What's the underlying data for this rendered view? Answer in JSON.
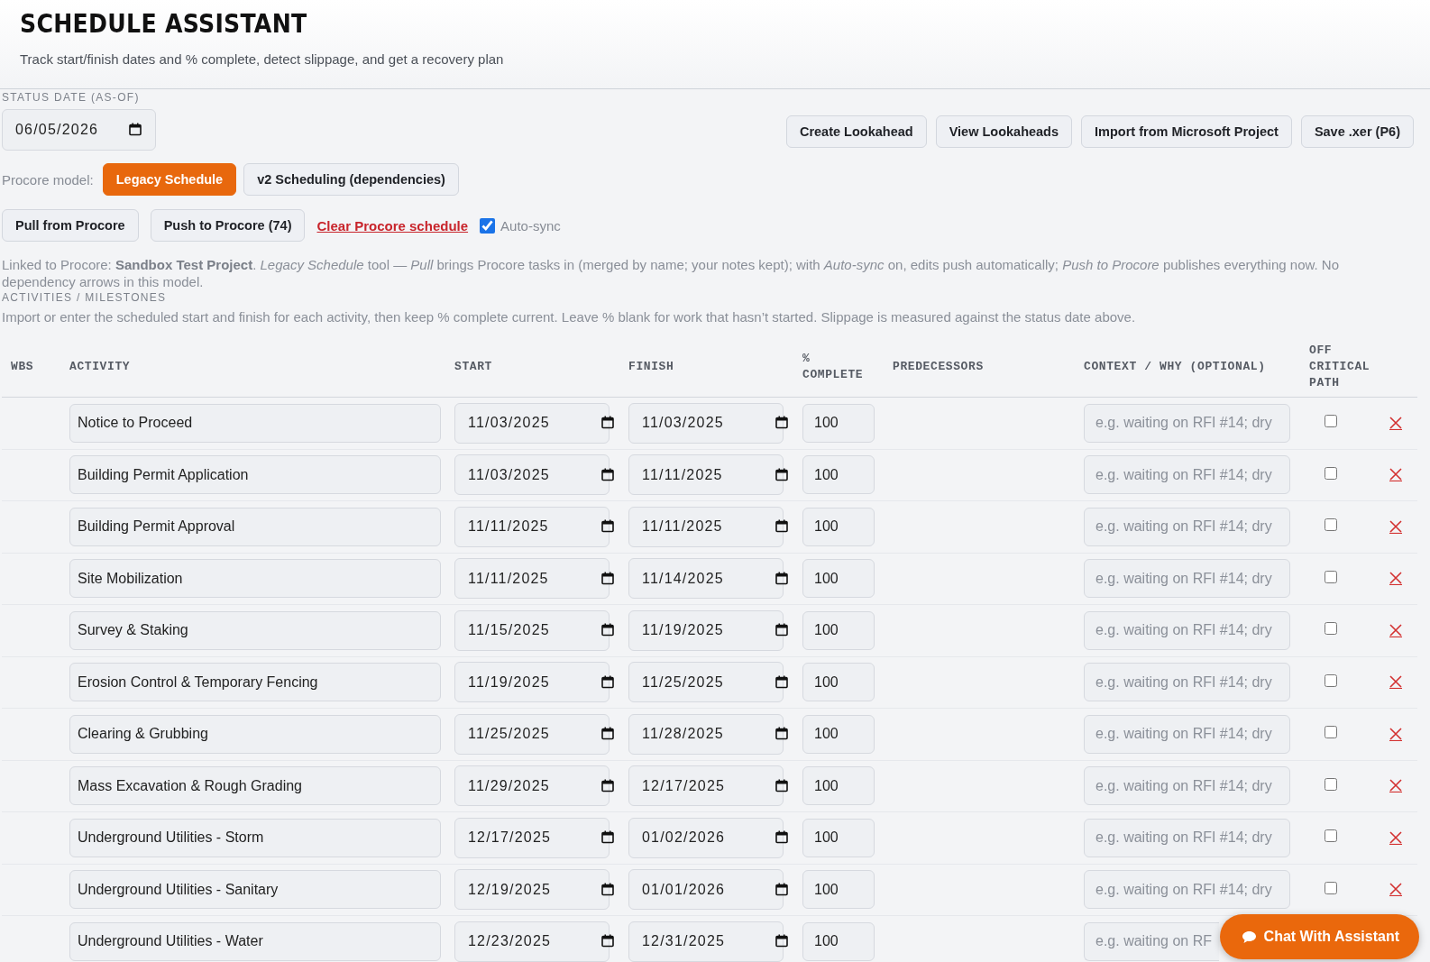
{
  "header": {
    "title": "SCHEDULE ASSISTANT",
    "subtitle": "Track start/finish dates and % complete, detect slippage, and get a recovery plan"
  },
  "status_date": {
    "label": "STATUS DATE (AS-OF)",
    "value": "06/05/2026"
  },
  "actions": [
    "Create Lookahead",
    "View Lookaheads",
    "Import from Microsoft Project",
    "Save .xer (P6)"
  ],
  "procore_model": {
    "label": "Procore model:",
    "options": [
      {
        "label": "Legacy Schedule",
        "selected": true
      },
      {
        "label": "v2 Scheduling (dependencies)",
        "selected": false
      }
    ]
  },
  "sync": {
    "pull": "Pull from Procore",
    "push": "Push to Procore (74)",
    "clear": "Clear Procore schedule",
    "auto_sync": {
      "label": "Auto-sync",
      "checked": true
    }
  },
  "info": "Linked to Procore: **Sandbox Test Project**. *Legacy Schedule* tool — *Pull* brings Procore tasks in (merged by name; your notes kept); with *Auto-sync* on, edits push automatically; *Push to Procore* publishes everything now. No dependency arrows in this model.",
  "section": {
    "title": "ACTIVITIES / MILESTONES",
    "hint": "Import or enter the scheduled start and finish for each activity, then keep % complete current. Leave % blank for work that hasn’t started. Slippage is measured against the status date above."
  },
  "table": {
    "columns": [
      "WBS",
      "ACTIVITY",
      "START",
      "FINISH",
      "% COMPLETE",
      "PREDECESSORS",
      "CONTEXT / WHY (OPTIONAL)",
      "OFF CRITICAL PATH"
    ],
    "rows": [
      {
        "activity": "Notice to Proceed",
        "start": "11/03/2025",
        "finish": "11/03/2025",
        "percent_complete": "100",
        "context_placeholder": "e.g. waiting on RFI #14; dry",
        "off_critical_path": false
      },
      {
        "activity": "Building Permit Application",
        "start": "11/03/2025",
        "finish": "11/11/2025",
        "percent_complete": "100",
        "context_placeholder": "e.g. waiting on RFI #14; dry",
        "off_critical_path": false
      },
      {
        "activity": "Building Permit Approval",
        "start": "11/11/2025",
        "finish": "11/11/2025",
        "percent_complete": "100",
        "context_placeholder": "e.g. waiting on RFI #14; dry",
        "off_critical_path": false
      },
      {
        "activity": "Site Mobilization",
        "start": "11/11/2025",
        "finish": "11/14/2025",
        "percent_complete": "100",
        "context_placeholder": "e.g. waiting on RFI #14; dry",
        "off_critical_path": false
      },
      {
        "activity": "Survey & Staking",
        "start": "11/15/2025",
        "finish": "11/19/2025",
        "percent_complete": "100",
        "context_placeholder": "e.g. waiting on RFI #14; dry",
        "off_critical_path": false
      },
      {
        "activity": "Erosion Control & Temporary Fencing",
        "start": "11/19/2025",
        "finish": "11/25/2025",
        "percent_complete": "100",
        "context_placeholder": "e.g. waiting on RFI #14; dry",
        "off_critical_path": false
      },
      {
        "activity": "Clearing & Grubbing",
        "start": "11/25/2025",
        "finish": "11/28/2025",
        "percent_complete": "100",
        "context_placeholder": "e.g. waiting on RFI #14; dry",
        "off_critical_path": false
      },
      {
        "activity": "Mass Excavation & Rough Grading",
        "start": "11/29/2025",
        "finish": "12/17/2025",
        "percent_complete": "100",
        "context_placeholder": "e.g. waiting on RFI #14; dry",
        "off_critical_path": false
      },
      {
        "activity": "Underground Utilities - Storm",
        "start": "12/17/2025",
        "finish": "01/02/2026",
        "percent_complete": "100",
        "context_placeholder": "e.g. waiting on RFI #14; dry",
        "off_critical_path": false
      },
      {
        "activity": "Underground Utilities - Sanitary",
        "start": "12/19/2025",
        "finish": "01/01/2026",
        "percent_complete": "100",
        "context_placeholder": "e.g. waiting on RFI #14; dry",
        "off_critical_path": false
      },
      {
        "activity": "Underground Utilities - Water",
        "start": "12/23/2025",
        "finish": "12/31/2025",
        "percent_complete": "100",
        "context_placeholder": "e.g. waiting on RF"
      }
    ]
  },
  "chat_button": "Chat With Assistant"
}
